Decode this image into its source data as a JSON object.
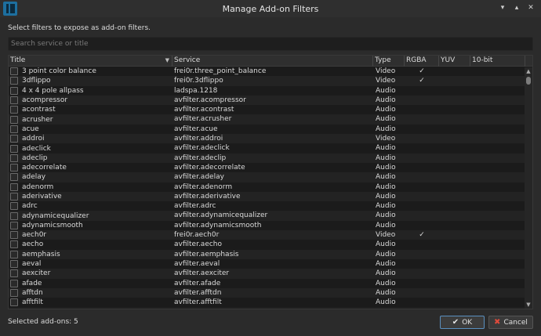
{
  "window": {
    "title": "Manage Add-on Filters",
    "controls": {
      "minimize": "▾",
      "maximize": "▴",
      "close": "✕"
    }
  },
  "instruction": "Select filters to expose as add-on filters.",
  "search": {
    "placeholder": "Search service or title",
    "value": ""
  },
  "table": {
    "columns": {
      "title": "Title",
      "service": "Service",
      "type": "Type",
      "rgba": "RGBA",
      "yuv": "YUV",
      "tenbit": "10-bit"
    },
    "rows": [
      {
        "title": "3 point color balance",
        "service": "frei0r.three_point_balance",
        "type": "Video",
        "rgba": "✓",
        "yuv": "",
        "tenbit": ""
      },
      {
        "title": "3dflippo",
        "service": "frei0r.3dflippo",
        "type": "Video",
        "rgba": "✓",
        "yuv": "",
        "tenbit": ""
      },
      {
        "title": "4 x 4 pole allpass",
        "service": "ladspa.1218",
        "type": "Audio",
        "rgba": "",
        "yuv": "",
        "tenbit": ""
      },
      {
        "title": "acompressor",
        "service": "avfilter.acompressor",
        "type": "Audio",
        "rgba": "",
        "yuv": "",
        "tenbit": ""
      },
      {
        "title": "acontrast",
        "service": "avfilter.acontrast",
        "type": "Audio",
        "rgba": "",
        "yuv": "",
        "tenbit": ""
      },
      {
        "title": "acrusher",
        "service": "avfilter.acrusher",
        "type": "Audio",
        "rgba": "",
        "yuv": "",
        "tenbit": ""
      },
      {
        "title": "acue",
        "service": "avfilter.acue",
        "type": "Audio",
        "rgba": "",
        "yuv": "",
        "tenbit": ""
      },
      {
        "title": "addroi",
        "service": "avfilter.addroi",
        "type": "Video",
        "rgba": "",
        "yuv": "",
        "tenbit": ""
      },
      {
        "title": "adeclick",
        "service": "avfilter.adeclick",
        "type": "Audio",
        "rgba": "",
        "yuv": "",
        "tenbit": ""
      },
      {
        "title": "adeclip",
        "service": "avfilter.adeclip",
        "type": "Audio",
        "rgba": "",
        "yuv": "",
        "tenbit": ""
      },
      {
        "title": "adecorrelate",
        "service": "avfilter.adecorrelate",
        "type": "Audio",
        "rgba": "",
        "yuv": "",
        "tenbit": ""
      },
      {
        "title": "adelay",
        "service": "avfilter.adelay",
        "type": "Audio",
        "rgba": "",
        "yuv": "",
        "tenbit": ""
      },
      {
        "title": "adenorm",
        "service": "avfilter.adenorm",
        "type": "Audio",
        "rgba": "",
        "yuv": "",
        "tenbit": ""
      },
      {
        "title": "aderivative",
        "service": "avfilter.aderivative",
        "type": "Audio",
        "rgba": "",
        "yuv": "",
        "tenbit": ""
      },
      {
        "title": "adrc",
        "service": "avfilter.adrc",
        "type": "Audio",
        "rgba": "",
        "yuv": "",
        "tenbit": ""
      },
      {
        "title": "adynamicequalizer",
        "service": "avfilter.adynamicequalizer",
        "type": "Audio",
        "rgba": "",
        "yuv": "",
        "tenbit": ""
      },
      {
        "title": "adynamicsmooth",
        "service": "avfilter.adynamicsmooth",
        "type": "Audio",
        "rgba": "",
        "yuv": "",
        "tenbit": ""
      },
      {
        "title": "aech0r",
        "service": "frei0r.aech0r",
        "type": "Video",
        "rgba": "✓",
        "yuv": "",
        "tenbit": ""
      },
      {
        "title": "aecho",
        "service": "avfilter.aecho",
        "type": "Audio",
        "rgba": "",
        "yuv": "",
        "tenbit": ""
      },
      {
        "title": "aemphasis",
        "service": "avfilter.aemphasis",
        "type": "Audio",
        "rgba": "",
        "yuv": "",
        "tenbit": ""
      },
      {
        "title": "aeval",
        "service": "avfilter.aeval",
        "type": "Audio",
        "rgba": "",
        "yuv": "",
        "tenbit": ""
      },
      {
        "title": "aexciter",
        "service": "avfilter.aexciter",
        "type": "Audio",
        "rgba": "",
        "yuv": "",
        "tenbit": ""
      },
      {
        "title": "afade",
        "service": "avfilter.afade",
        "type": "Audio",
        "rgba": "",
        "yuv": "",
        "tenbit": ""
      },
      {
        "title": "afftdn",
        "service": "avfilter.afftdn",
        "type": "Audio",
        "rgba": "",
        "yuv": "",
        "tenbit": ""
      },
      {
        "title": "afftfilt",
        "service": "avfilter.afftfilt",
        "type": "Audio",
        "rgba": "",
        "yuv": "",
        "tenbit": ""
      }
    ]
  },
  "status": "Selected add-ons: 5",
  "buttons": {
    "ok": "OK",
    "cancel": "Cancel"
  },
  "icons": {
    "ok": "✔",
    "cancel": "✖",
    "sort": "▼",
    "scroll_up": "▲",
    "scroll_down": "▼"
  },
  "colors": {
    "background": "#2b2b2b",
    "accent": "#5a8fbf",
    "cancel_icon": "#e04a3b",
    "app_icon": "#1d6f9f"
  }
}
